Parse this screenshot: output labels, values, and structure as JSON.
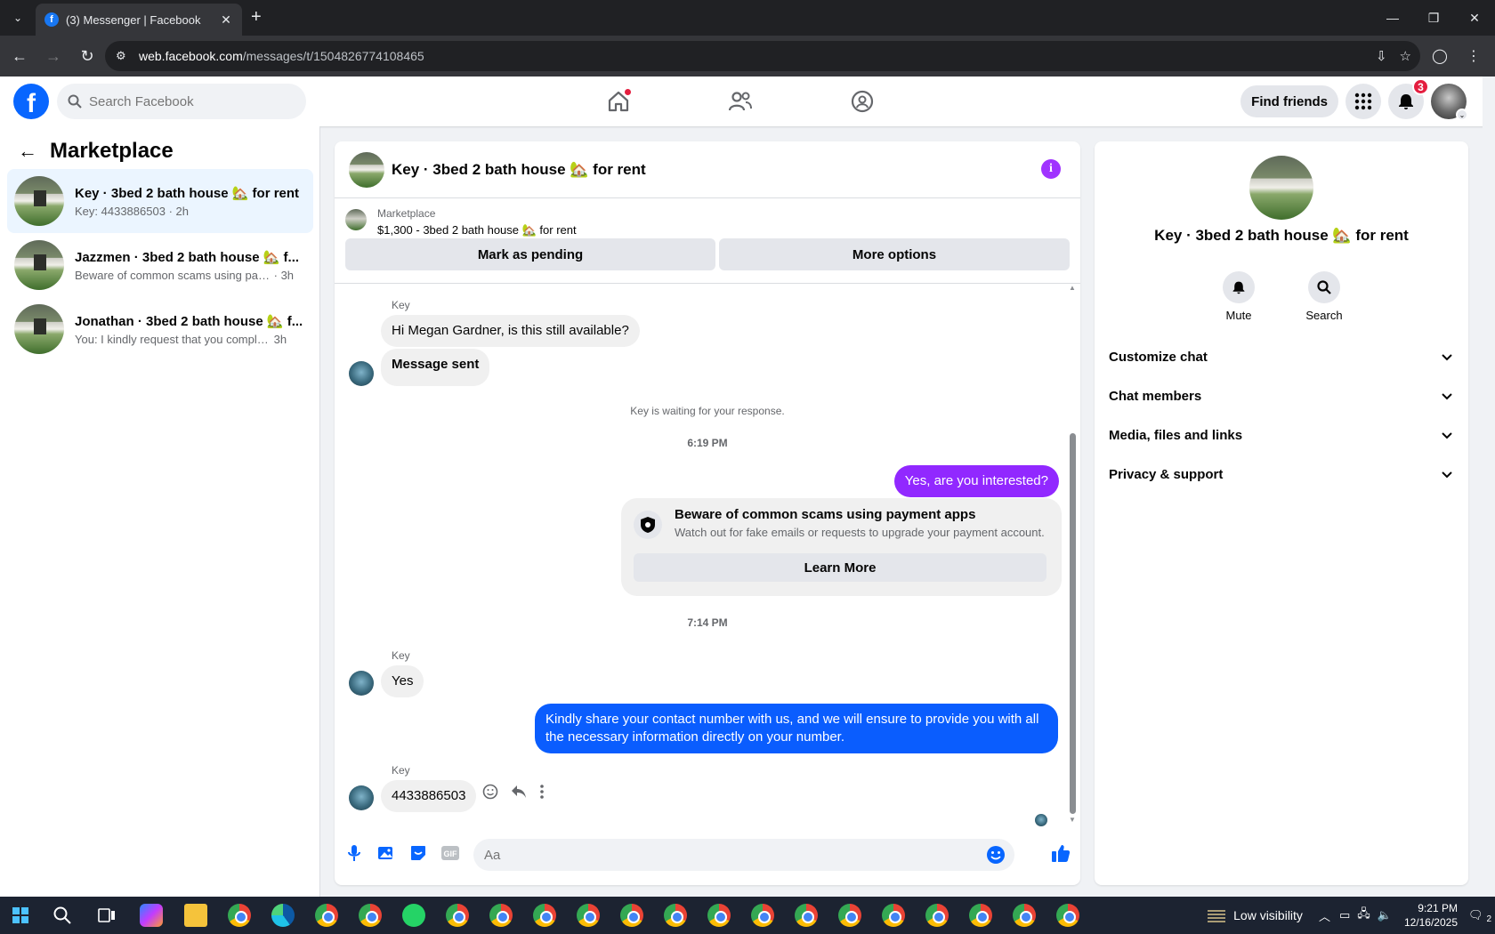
{
  "browser": {
    "tab_title": "(3) Messenger | Facebook",
    "url_host": "web.facebook.com",
    "url_path": "/messages/t/1504826774108465"
  },
  "fb": {
    "search_placeholder": "Search Facebook",
    "find_friends": "Find friends",
    "notification_count": "3"
  },
  "left": {
    "title": "Marketplace",
    "conversations": [
      {
        "name": "Key · 3bed 2 bath house 🏡 for rent",
        "snippet": "Key: 4433886503",
        "time": "· 2h"
      },
      {
        "name": "Jazzmen · 3bed 2 bath house 🏡 f...",
        "snippet": "Beware of common scams using pay...",
        "time": "· 3h"
      },
      {
        "name": "Jonathan · 3bed 2 bath house 🏡 f...",
        "snippet": "You: I kindly request that you complet...",
        "time": "3h"
      }
    ]
  },
  "chat": {
    "title": "Key · 3bed 2 bath house 🏡 for rent",
    "listing_source": "Marketplace",
    "listing_desc": "$1,300 - 3bed 2 bath house 🏡 for rent",
    "mark_pending": "Mark as pending",
    "more_options": "More options",
    "messages": {
      "sender1": "Key",
      "m1": "Hi Megan Gardner, is this still available?",
      "m2": "Message sent",
      "waiting": "Key is waiting for your response.",
      "time1": "6:19 PM",
      "m3": "Yes, are you interested?",
      "scam_title": "Beware of common scams using payment apps",
      "scam_desc": "Watch out for fake emails or requests to upgrade your payment account.",
      "learn_more": "Learn More",
      "time2": "7:14 PM",
      "sender2": "Key",
      "m4": "Yes",
      "m5": "Kindly share your contact number with us, and we will ensure to provide you with all the necessary information directly on your number.",
      "sender3": "Key",
      "m6": "4433886503"
    },
    "composer_placeholder": "Aa"
  },
  "right": {
    "title": "Key · 3bed 2 bath house 🏡 for rent",
    "mute": "Mute",
    "search": "Search",
    "sections": [
      "Customize chat",
      "Chat members",
      "Media, files and links",
      "Privacy & support"
    ]
  },
  "taskbar": {
    "weather": "Low visibility",
    "time": "9:21 PM",
    "date": "12/16/2025",
    "notif": "2"
  }
}
